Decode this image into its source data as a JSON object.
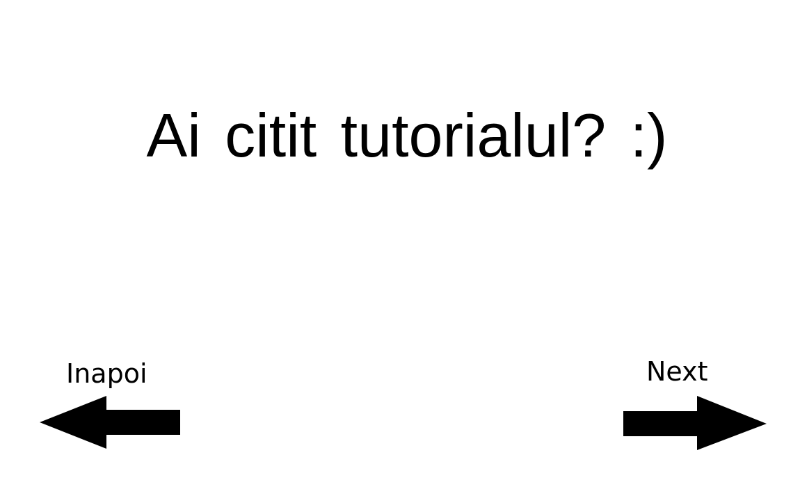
{
  "screen": {
    "question": "Ai citit tutorialul? :)"
  },
  "navigation": {
    "back": {
      "label": "Inapoi",
      "icon": "arrow-left-icon"
    },
    "next": {
      "label": "Next",
      "icon": "arrow-right-icon"
    }
  },
  "colors": {
    "background": "#ffffff",
    "foreground": "#000000"
  }
}
